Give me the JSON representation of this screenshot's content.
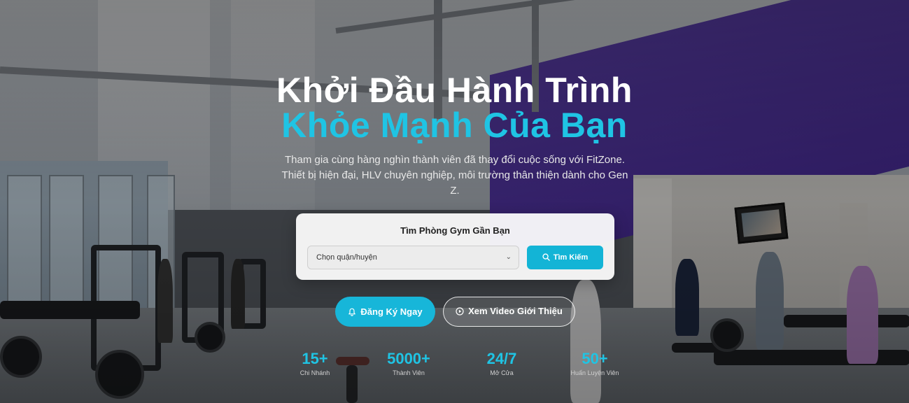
{
  "hero": {
    "title_line1": "Khởi Đầu Hành Trình",
    "title_line2": "Khỏe Mạnh Của Bạn",
    "subtitle": "Tham gia cùng hàng nghìn thành viên đã thay đổi cuộc sống với FitZone. Thiết bị hiện đại, HLV chuyên nghiệp, môi trường thân thiện dành cho Gen Z."
  },
  "search": {
    "title": "Tìm Phòng Gym Gần Bạn",
    "select_value": "Chọn quận/huyện",
    "button_label": "Tìm Kiếm"
  },
  "cta": {
    "register_label": "Đăng Ký Ngay",
    "video_label": "Xem Video Giới Thiệu"
  },
  "stats": [
    {
      "value": "15+",
      "label": "Chi Nhánh"
    },
    {
      "value": "5000+",
      "label": "Thành Viên"
    },
    {
      "value": "24/7",
      "label": "Mở Cửa"
    },
    {
      "value": "50+",
      "label": "Huấn Luyện Viên"
    }
  ],
  "colors": {
    "accent": "#1fc4e4",
    "button": "#17b6d9",
    "purple_wall": "#5d3fb0"
  },
  "icons": {
    "search": "search-icon",
    "register": "bell-icon",
    "video": "play-circle-icon",
    "dropdown": "chevron-down-icon"
  }
}
